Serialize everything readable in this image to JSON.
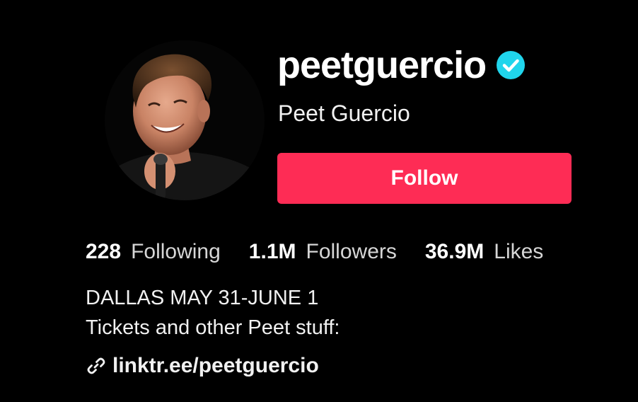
{
  "profile": {
    "username": "peetguercio",
    "display_name": "Peet Guercio",
    "verified": true,
    "avatar_alt": "profile photo",
    "follow_label": "Follow"
  },
  "stats": {
    "following_value": "228",
    "following_label": "Following",
    "followers_value": "1.1M",
    "followers_label": "Followers",
    "likes_value": "36.9M",
    "likes_label": "Likes"
  },
  "bio": {
    "line1": "DALLAS MAY 31-JUNE 1",
    "line2": "Tickets and other Peet stuff:",
    "link_text": "linktr.ee/peetguercio",
    "link_icon": "link-icon"
  },
  "colors": {
    "background": "#000000",
    "follow_button": "#fe2c55",
    "verified_badge": "#20d5ec",
    "text_primary": "#ffffff",
    "text_secondary": "#d6d6d6"
  }
}
